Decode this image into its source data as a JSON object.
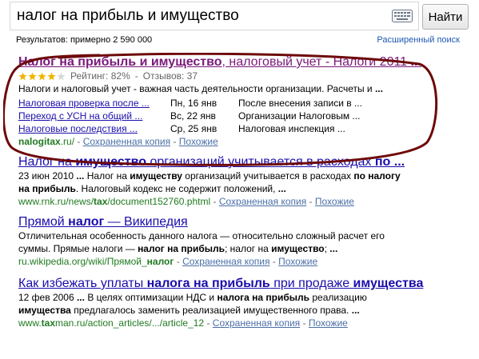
{
  "search": {
    "query": "налог на прибыль и имущество",
    "button_label": "Найти"
  },
  "meta": {
    "results_count": "Результатов: примерно 2 590 000",
    "advanced_search": "Расширенный поиск"
  },
  "results": [
    {
      "title_parts": [
        {
          "text": "Налог на прибыль и имущество",
          "bold": true
        },
        {
          "text": ", налоговый учет - Налоги 2011 ",
          "bold": false
        },
        {
          "text": "...",
          "bold": true
        }
      ],
      "visited": true,
      "rating": {
        "stars_filled": 4,
        "stars_total": 5,
        "label": "Рейтинг: 82%",
        "separator": "-",
        "reviews": "Отзывов: 37"
      },
      "snippet": [
        [
          {
            "text": "Налоги и налоговый учет - важная часть деятельности организации. Расчеты и ",
            "bold": false
          },
          {
            "text": "...",
            "bold": true
          }
        ]
      ],
      "sitelinks": [
        {
          "title": "Налоговая проверка после ...",
          "date": "Пн, 16 янв",
          "desc": "После внесения записи в ..."
        },
        {
          "title": "Переход с УСН на общий ...",
          "date": "Вс, 22 янв",
          "desc": "Организации Налоговым ..."
        },
        {
          "title": "Налоговые последствия ...",
          "date": "Ср, 25 янв",
          "desc": "Налоговая инспекция ..."
        }
      ],
      "url_parts": [
        {
          "text": "nalogitax",
          "bold": true
        },
        {
          "text": ".ru/",
          "bold": false
        }
      ],
      "separator": "-",
      "cache_link": "Сохраненная копия",
      "similar_link": "Похожие"
    },
    {
      "title_parts": [
        {
          "text": "Налог на ",
          "bold": false
        },
        {
          "text": "имущество",
          "bold": true
        },
        {
          "text": " организаций учитывается в расходах ",
          "bold": false
        },
        {
          "text": "по ...",
          "bold": true
        }
      ],
      "visited": false,
      "snippet": [
        [
          {
            "text": "23 июн 2010 ",
            "bold": false
          },
          {
            "text": "...",
            "bold": true
          },
          {
            "text": " Налог на ",
            "bold": false
          },
          {
            "text": "имуществу",
            "bold": true
          },
          {
            "text": " организаций учитывается в расходах ",
            "bold": false
          },
          {
            "text": "по налогу",
            "bold": true
          }
        ],
        [
          {
            "text": "на прибыль",
            "bold": true
          },
          {
            "text": ". Налоговый кодекс не содержит положений, ",
            "bold": false
          },
          {
            "text": "...",
            "bold": true
          }
        ]
      ],
      "url_parts": [
        {
          "text": "www.rnk.ru/news/",
          "bold": false
        },
        {
          "text": "tax",
          "bold": true
        },
        {
          "text": "/document152760.phtml",
          "bold": false
        }
      ],
      "separator": "-",
      "cache_link": "Сохраненная копия",
      "similar_link": "Похожие"
    },
    {
      "title_parts": [
        {
          "text": "Прямой ",
          "bold": false
        },
        {
          "text": "налог",
          "bold": true
        },
        {
          "text": " — Википедия",
          "bold": false
        }
      ],
      "visited": false,
      "snippet": [
        [
          {
            "text": "Отличительная особенность данного налога — относительно сложный расчет его",
            "bold": false
          }
        ],
        [
          {
            "text": "суммы. Прямые налоги — ",
            "bold": false
          },
          {
            "text": "налог на прибыль",
            "bold": true
          },
          {
            "text": "; налог на ",
            "bold": false
          },
          {
            "text": "имущество",
            "bold": true
          },
          {
            "text": "; ",
            "bold": false
          },
          {
            "text": "...",
            "bold": true
          }
        ]
      ],
      "url_parts": [
        {
          "text": "ru.wikipedia.org/wiki/Прямой_",
          "bold": false
        },
        {
          "text": "налог",
          "bold": true
        }
      ],
      "separator": "-",
      "cache_link": "Сохраненная копия",
      "similar_link": "Похожие"
    },
    {
      "title_parts": [
        {
          "text": "Как избежать уплаты ",
          "bold": false
        },
        {
          "text": "налога на прибыль",
          "bold": true
        },
        {
          "text": " при продаже ",
          "bold": false
        },
        {
          "text": "имущества",
          "bold": true
        }
      ],
      "visited": false,
      "snippet": [
        [
          {
            "text": "12 фев 2006 ",
            "bold": false
          },
          {
            "text": "...",
            "bold": true
          },
          {
            "text": " В целях оптимизации НДС и ",
            "bold": false
          },
          {
            "text": "налога на прибыль",
            "bold": true
          },
          {
            "text": " реализацию",
            "bold": false
          }
        ],
        [
          {
            "text": "имущества",
            "bold": true
          },
          {
            "text": " предлагалось заменить реализацией имущественного права. ",
            "bold": false
          },
          {
            "text": "...",
            "bold": true
          }
        ]
      ],
      "url_parts": [
        {
          "text": "www.",
          "bold": false
        },
        {
          "text": "tax",
          "bold": true
        },
        {
          "text": "man.ru/action_articles/.../article_12",
          "bold": false
        }
      ],
      "separator": "-",
      "cache_link": "Сохраненная копия",
      "similar_link": "Похожие"
    }
  ],
  "colors": {
    "link": "#1a0dab",
    "visited": "#7a1a7a",
    "url": "#1f7a1f",
    "star": "#f0b400",
    "annotation": "#6e0a0a"
  }
}
